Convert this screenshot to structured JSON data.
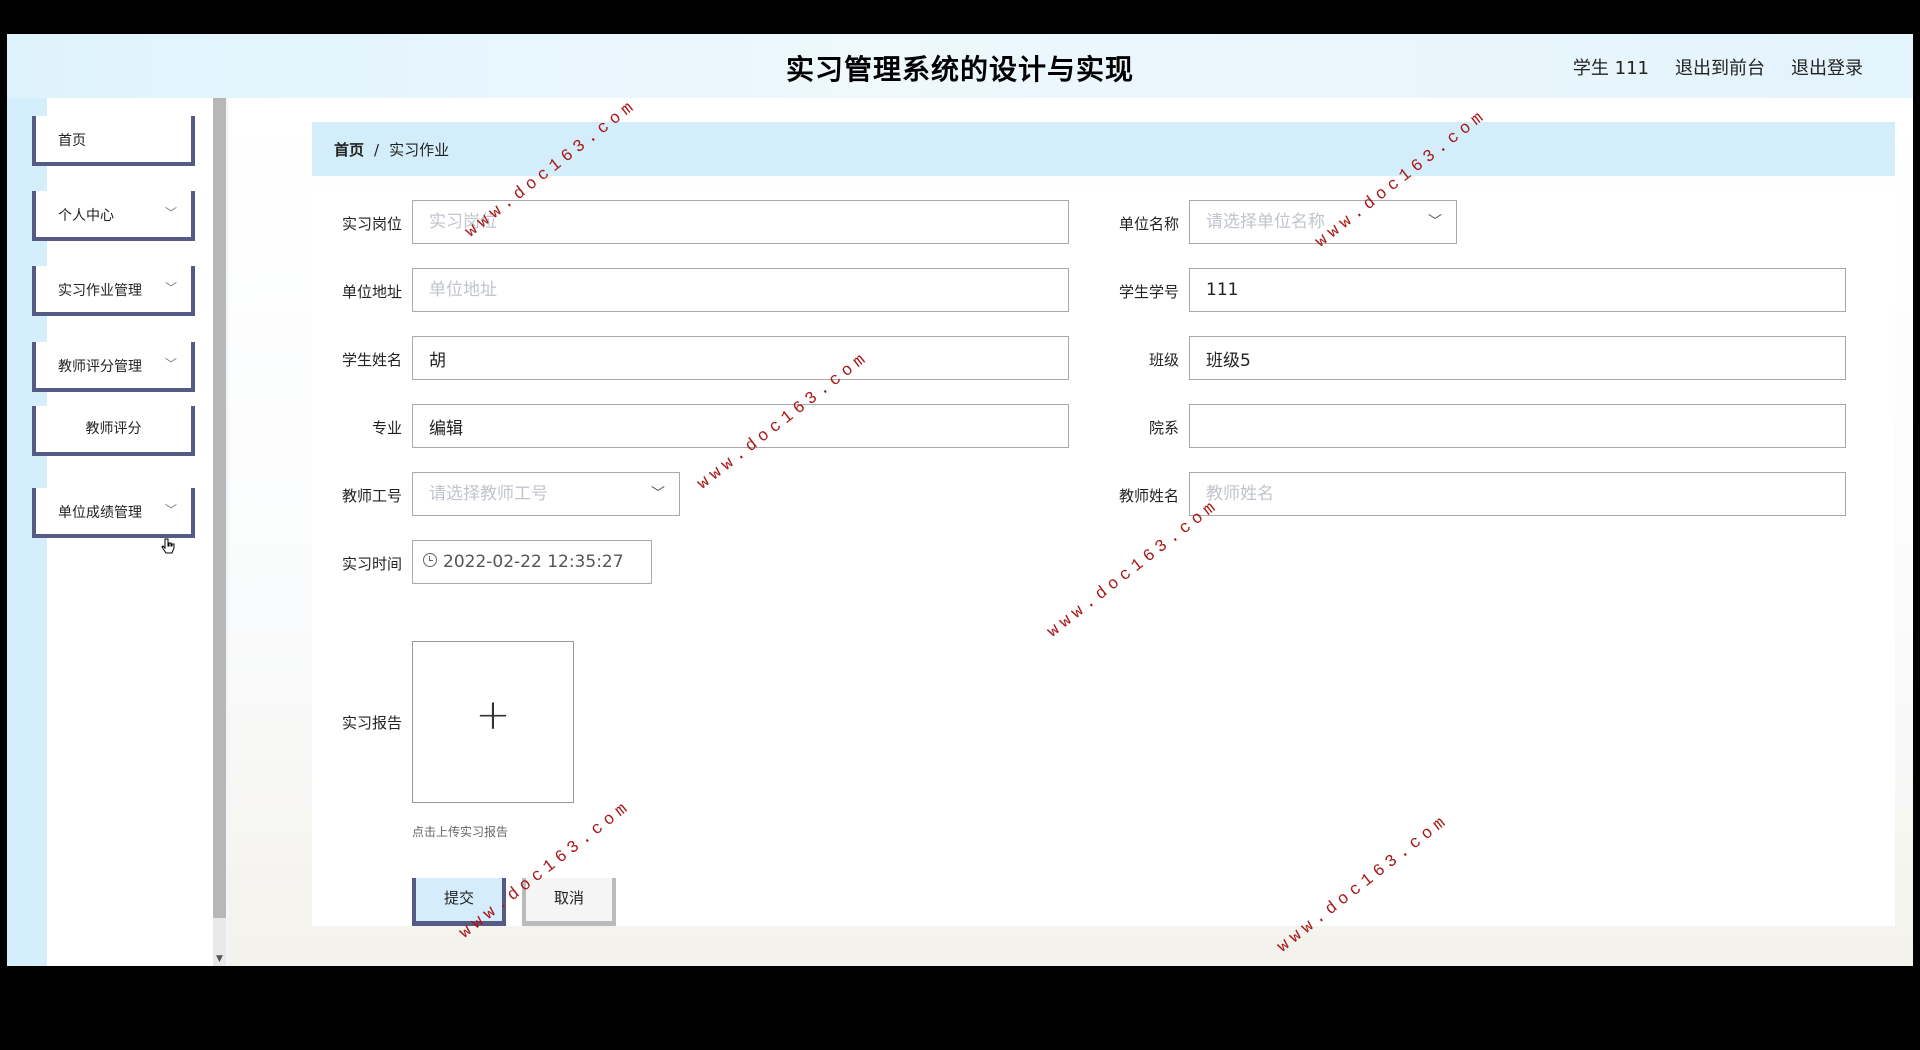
{
  "header": {
    "app_title": "实习管理系统的设计与实现",
    "user": "学生 111",
    "to_front": "退出到前台",
    "logout": "退出登录"
  },
  "sidebar": {
    "items": [
      {
        "label": "首页",
        "chevron": false
      },
      {
        "label": "个人中心",
        "chevron": true
      },
      {
        "label": "实习作业管理",
        "chevron": true
      },
      {
        "label": "教师评分管理",
        "chevron": true
      },
      {
        "label": "教师评分",
        "chevron": false,
        "sub": true
      },
      {
        "label": "单位成绩管理",
        "chevron": true
      }
    ]
  },
  "breadcrumb": {
    "home": "首页",
    "separator": "/",
    "current": "实习作业"
  },
  "form": {
    "position": {
      "label": "实习岗位",
      "value": "",
      "placeholder": "实习岗位"
    },
    "unit_name": {
      "label": "单位名称",
      "placeholder": "请选择单位名称"
    },
    "unit_address": {
      "label": "单位地址",
      "value": "",
      "placeholder": "单位地址"
    },
    "student_no": {
      "label": "学生学号",
      "value": "111"
    },
    "student_name": {
      "label": "学生姓名",
      "value": "胡"
    },
    "class": {
      "label": "班级",
      "value": "班级5"
    },
    "major": {
      "label": "专业",
      "value": "编辑"
    },
    "department": {
      "label": "院系",
      "value": ""
    },
    "teacher_no": {
      "label": "教师工号",
      "placeholder": "请选择教师工号"
    },
    "teacher_name": {
      "label": "教师姓名",
      "value": "",
      "placeholder": "教师姓名"
    },
    "intern_time": {
      "label": "实习时间",
      "value": "2022-02-22 12:35:27"
    },
    "report": {
      "label": "实习报告",
      "tip": "点击上传实习报告"
    },
    "submit": "提交",
    "cancel": "取消"
  },
  "watermark": "www.doc163.com"
}
